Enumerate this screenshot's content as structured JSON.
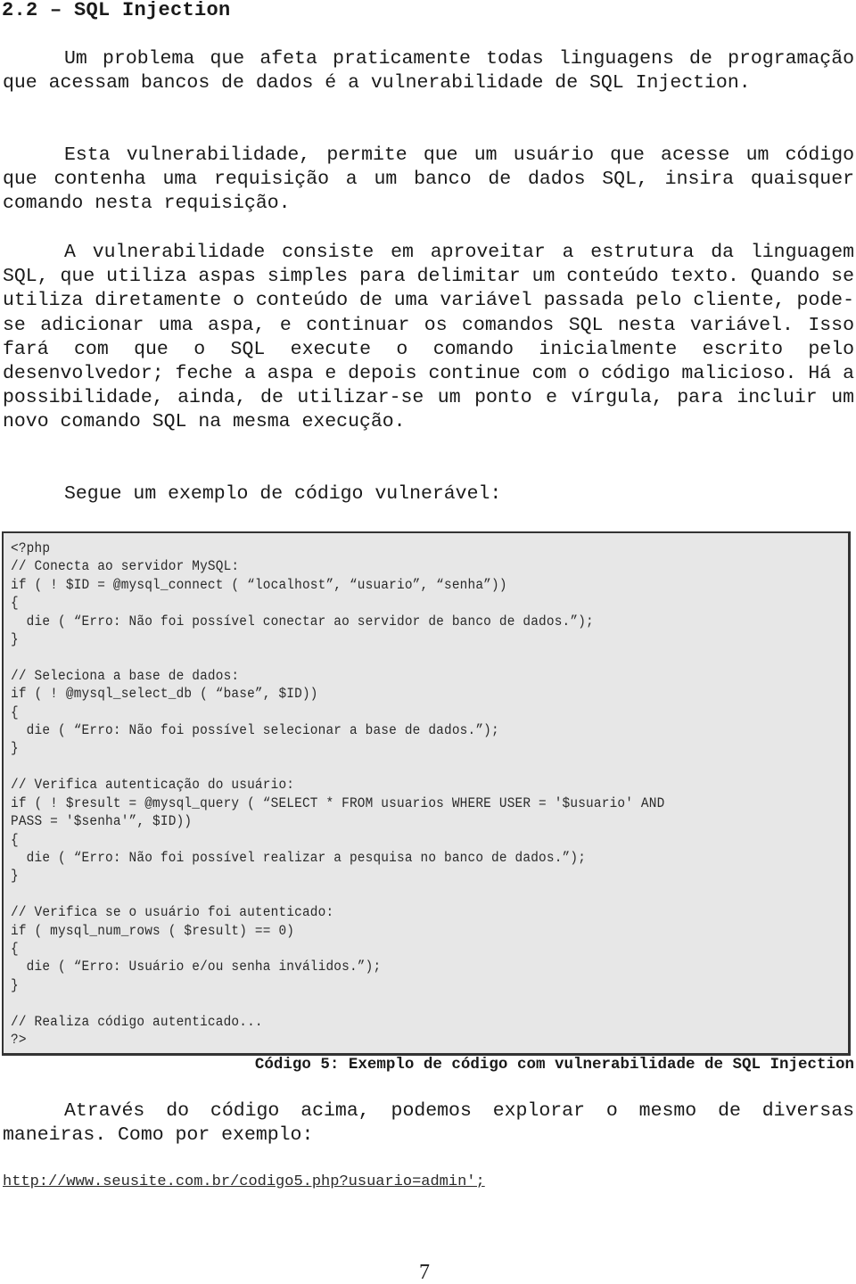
{
  "section": {
    "title": "2.2 – SQL Injection"
  },
  "paragraphs": [
    "Um problema que afeta praticamente todas linguagens de programação que acessam bancos de dados é a vulnerabilidade de SQL Injection.",
    "Esta vulnerabilidade, permite que um usuário que acesse um código que contenha uma requisição a um banco de dados SQL, insira quaisquer comando nesta requisição.",
    "A vulnerabilidade consiste em aproveitar a estrutura da linguagem SQL, que utiliza aspas simples para delimitar um conteúdo texto. Quando se utiliza diretamente o conteúdo de uma variável passada pelo cliente, pode-se adicionar uma aspa, e continuar os comandos SQL nesta variável. Isso fará com que o SQL execute o comando inicialmente escrito pelo desenvolvedor; feche a aspa e depois continue com o código malicioso. Há a possibilidade, ainda, de utilizar-se um ponto e vírgula, para incluir um novo comando SQL na mesma execução.",
    "Segue um exemplo de código vulnerável:"
  ],
  "code_block": {
    "lines": [
      "<?php",
      "// Conecta ao servidor MySQL:",
      "if ( ! $ID = @mysql_connect ( “localhost”, “usuario”, “senha”))",
      "{",
      "  die ( “Erro: Não foi possível conectar ao servidor de banco de dados.”);",
      "}",
      "",
      "// Seleciona a base de dados:",
      "if ( ! @mysql_select_db ( “base”, $ID))",
      "{",
      "  die ( “Erro: Não foi possível selecionar a base de dados.”);",
      "}",
      "",
      "// Verifica autenticação do usuário:",
      "if ( ! $result = @mysql_query ( “SELECT * FROM usuarios WHERE USER = '$usuario' AND",
      "PASS = '$senha'”, $ID))",
      "{",
      "  die ( “Erro: Não foi possível realizar a pesquisa no banco de dados.”);",
      "}",
      "",
      "// Verifica se o usuário foi autenticado:",
      "if ( mysql_num_rows ( $result) == 0)",
      "{",
      "  die ( “Erro: Usuário e/ou senha inválidos.”);",
      "}",
      "",
      "// Realiza código autenticado...",
      "?>"
    ],
    "caption": "Código 5: Exemplo de código com vulnerabilidade de SQL Injection"
  },
  "after_code": {
    "paragraph": "Através do código acima, podemos explorar o mesmo de diversas maneiras. Como por exemplo:",
    "example_url": "http://www.seusite.com.br/codigo5.php?usuario=admin';"
  },
  "footer": {
    "page_number": "7"
  }
}
